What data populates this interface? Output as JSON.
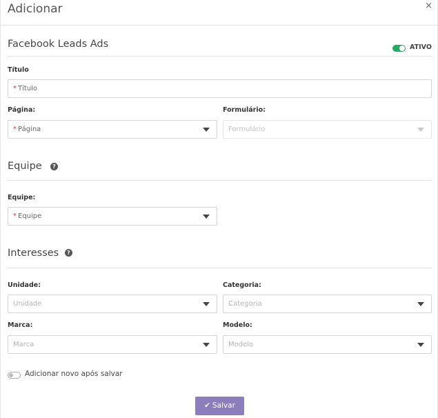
{
  "modal": {
    "title": "Adicionar",
    "close_glyph": "×"
  },
  "facebook": {
    "section_title": "Facebook Leads Ads",
    "active_label": "ATIVO",
    "active": true,
    "titulo": {
      "label": "Título",
      "placeholder": "Título",
      "required": true
    },
    "pagina": {
      "label": "Página:",
      "placeholder": "Página",
      "required": true
    },
    "formulario": {
      "label": "Formulário:",
      "placeholder": "Formulário",
      "disabled": true
    }
  },
  "equipe": {
    "section_title": "Equipe",
    "help_glyph": "?",
    "field": {
      "label": "Equipe:",
      "placeholder": "Equipe",
      "required": true
    }
  },
  "interesses": {
    "section_title": "Interesses",
    "help_glyph": "?",
    "unidade": {
      "label": "Unidade:",
      "placeholder": "Unidade"
    },
    "categoria": {
      "label": "Categoria:",
      "placeholder": "Categoria"
    },
    "marca": {
      "label": "Marca:",
      "placeholder": "Marca"
    },
    "modelo": {
      "label": "Modelo:",
      "placeholder": "Modelo"
    }
  },
  "footer": {
    "add_new_label": "Adicionar novo após salvar",
    "add_new_enabled": false,
    "save_label": "Salvar",
    "save_icon": "check-icon"
  },
  "colors": {
    "toggle_on": "#2aa866",
    "save_button": "#8c7dbd",
    "required_mark": "#d9363e"
  }
}
